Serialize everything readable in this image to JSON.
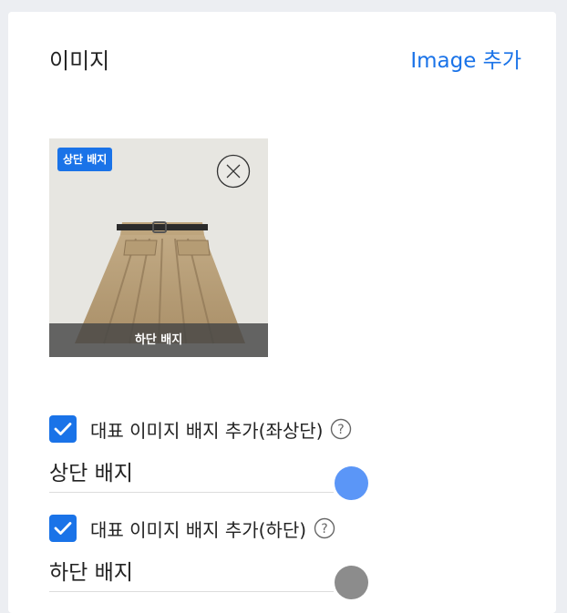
{
  "section": {
    "title": "이미지",
    "add_link": "Image 추가"
  },
  "image": {
    "top_badge": "상단 배지",
    "bottom_badge": "하단 배지"
  },
  "options": [
    {
      "label": "대표 이미지 배지 추가(좌상단)",
      "checked": true,
      "field_value": "상단 배지",
      "color": "#5b96f7"
    },
    {
      "label": "대표 이미지 배지 추가(하단)",
      "checked": true,
      "field_value": "하단 배지",
      "color": "#8c8c8c"
    }
  ],
  "colors": {
    "accent": "#1a73e8"
  }
}
